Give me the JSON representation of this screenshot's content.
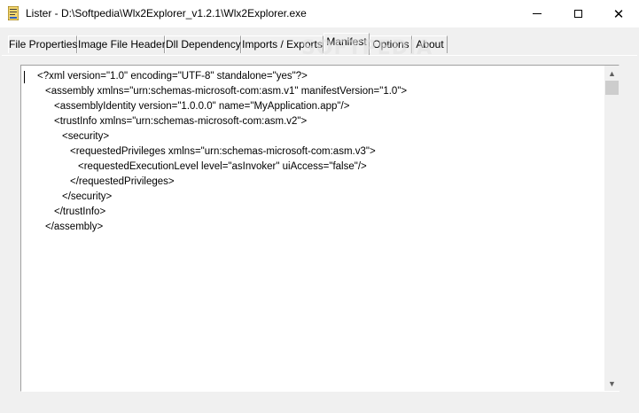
{
  "window": {
    "title": "Lister - D:\\Softpedia\\Wlx2Explorer_v1.2.1\\Wlx2Explorer.exe",
    "icon": "lister-app-icon",
    "controls": {
      "minimize_icon": "minimize-icon",
      "maximize_icon": "maximize-icon",
      "close_glyph": "✕"
    }
  },
  "tabs": [
    {
      "label": "File Properties",
      "active": false
    },
    {
      "label": "Image File Header",
      "active": false
    },
    {
      "label": "Dll Dependency",
      "active": false
    },
    {
      "label": "Imports / Exports",
      "active": false
    },
    {
      "label": "Manifest",
      "active": true
    },
    {
      "label": "Options",
      "active": false
    },
    {
      "label": "About",
      "active": false
    }
  ],
  "watermark": "SOFTPEDIA",
  "manifest": {
    "lines": [
      "<?xml version=\"1.0\" encoding=\"UTF-8\" standalone=\"yes\"?>",
      "<assembly xmlns=\"urn:schemas-microsoft-com:asm.v1\" manifestVersion=\"1.0\">",
      "<assemblyIdentity version=\"1.0.0.0\" name=\"MyApplication.app\"/>",
      "<trustInfo xmlns=\"urn:schemas-microsoft-com:asm.v2\">",
      "<security>",
      "<requestedPrivileges xmlns=\"urn:schemas-microsoft-com:asm.v3\">",
      "<requestedExecutionLevel level=\"asInvoker\" uiAccess=\"false\"/>",
      "</requestedPrivileges>",
      "</security>",
      "</trustInfo>",
      "</assembly>"
    ]
  },
  "scrollbar": {
    "up_arrow": "▲",
    "down_arrow": "▼"
  },
  "colors": {
    "window_bg": "#f0f0f0",
    "editor_bg": "#ffffff",
    "scroll_thumb": "#cdcdcd"
  }
}
